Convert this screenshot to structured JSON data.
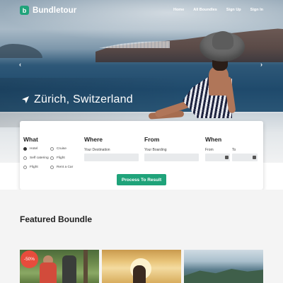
{
  "brand": {
    "name": "Bundletour",
    "logo_letter": "b",
    "accent": "#1fa37a"
  },
  "nav": {
    "items": [
      "Home",
      "All Boundles",
      "Sign Up",
      "Sign In"
    ]
  },
  "hero": {
    "location": "Zürich, Switzerland",
    "prev_icon": "chevron-left-icon",
    "next_icon": "chevron-right-icon"
  },
  "search": {
    "what": {
      "title": "What",
      "options": [
        {
          "label": "Hotel",
          "selected": true
        },
        {
          "label": "Cruise",
          "selected": false
        },
        {
          "label": "Self catering",
          "selected": false
        },
        {
          "label": "Flight",
          "selected": false
        },
        {
          "label": "Flight",
          "selected": false
        },
        {
          "label": "Rent a Car",
          "selected": false
        }
      ]
    },
    "where": {
      "title": "Where",
      "label": "Your Destination",
      "value": ""
    },
    "from": {
      "title": "From",
      "label": "Your Boarding",
      "value": ""
    },
    "when": {
      "title": "When",
      "from_label": "From",
      "to_label": "To",
      "from_value": "",
      "to_value": ""
    },
    "submit_label": "Process To Result"
  },
  "featured": {
    "title": "Featured Boundle",
    "items": [
      {
        "badge": "-50%"
      },
      {
        "badge": ""
      },
      {
        "badge": ""
      }
    ]
  }
}
